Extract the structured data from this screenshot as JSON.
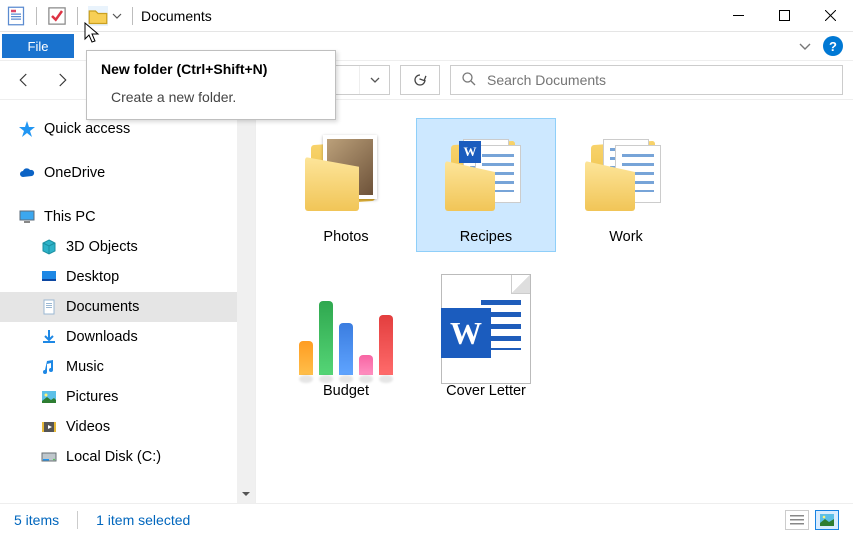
{
  "window": {
    "title": "Documents"
  },
  "ribbon": {
    "file_label": "File"
  },
  "tooltip": {
    "title": "New folder (Ctrl+Shift+N)",
    "body": "Create a new folder."
  },
  "search": {
    "placeholder": "Search Documents"
  },
  "sidebar": {
    "quick_access": "Quick access",
    "onedrive": "OneDrive",
    "this_pc": "This PC",
    "items": [
      "3D Objects",
      "Desktop",
      "Documents",
      "Downloads",
      "Music",
      "Pictures",
      "Videos",
      "Local Disk (C:)"
    ]
  },
  "content": {
    "items": [
      {
        "label": "Photos"
      },
      {
        "label": "Recipes"
      },
      {
        "label": "Work"
      },
      {
        "label": "Budget"
      },
      {
        "label": "Cover Letter"
      }
    ]
  },
  "status": {
    "count": "5 items",
    "selected": "1 item selected"
  }
}
